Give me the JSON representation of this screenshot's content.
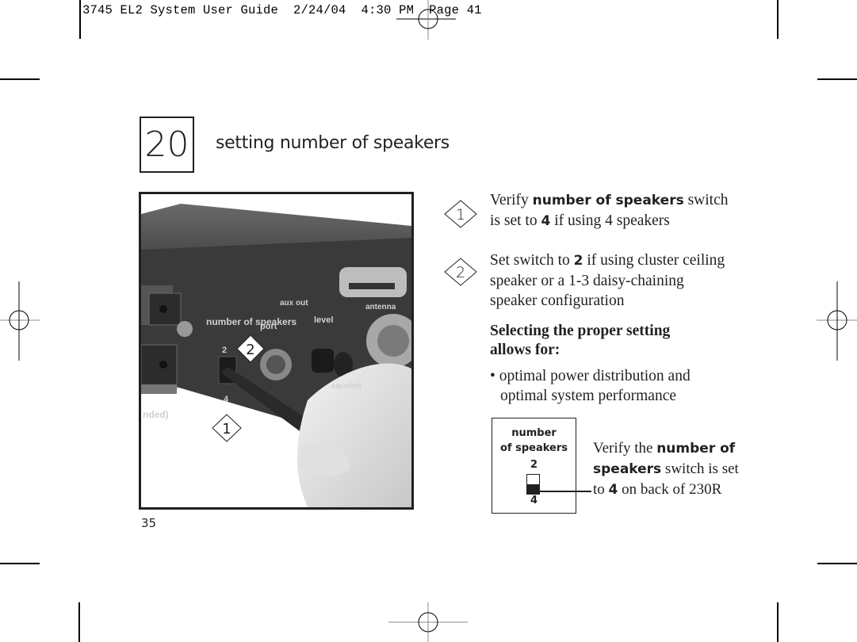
{
  "slug_line": "3745 EL2 System User Guide  2/24/04  4:30 PM  Page 41",
  "section": {
    "number": "20",
    "title": "setting number of speakers"
  },
  "photo": {
    "alt": "Back panel of 230R receiver with a pen pressing the number of speakers switch",
    "panel_labels": {
      "number_of_speakers": "number of speakers",
      "aux_out": "aux out",
      "port": "port",
      "level": "level",
      "antenna": "antenna",
      "squelch": "squelch",
      "switch_top": "2",
      "switch_bottom": "4",
      "recommended": "nded)"
    },
    "callouts": [
      "1",
      "2"
    ]
  },
  "steps": [
    {
      "marker": "1",
      "line1_pre": "Verify ",
      "line1_bold": "number of speakers",
      "line1_post": " switch",
      "line2_pre": "is set to ",
      "line2_bold": "4",
      "line2_post": " if using 4 speakers"
    },
    {
      "marker": "2",
      "line1_pre": "Set switch to ",
      "line1_bold": "2",
      "line1_post": " if using cluster ceiling",
      "line2": "speaker or a 1-3 daisy-chaining",
      "line3": "speaker configuration"
    }
  ],
  "subheading": {
    "line1": "Selecting the proper setting",
    "line2": "allows for:"
  },
  "bullets": [
    {
      "symbol": "•",
      "line1": "optimal power distribution and",
      "line2": "optimal system performance"
    }
  ],
  "diagram": {
    "label_line1": "number",
    "label_line2": "of speakers",
    "top_value": "2",
    "bottom_value": "4",
    "switch_position": "4",
    "caption": {
      "l1_pre": "Verify the ",
      "l1_bold": "number of",
      "l2_bold": "speakers",
      "l2_post": " switch is set",
      "l3_pre": "to ",
      "l3_bold": "4",
      "l3_post": " on back of 230R"
    }
  },
  "page_number": "35"
}
